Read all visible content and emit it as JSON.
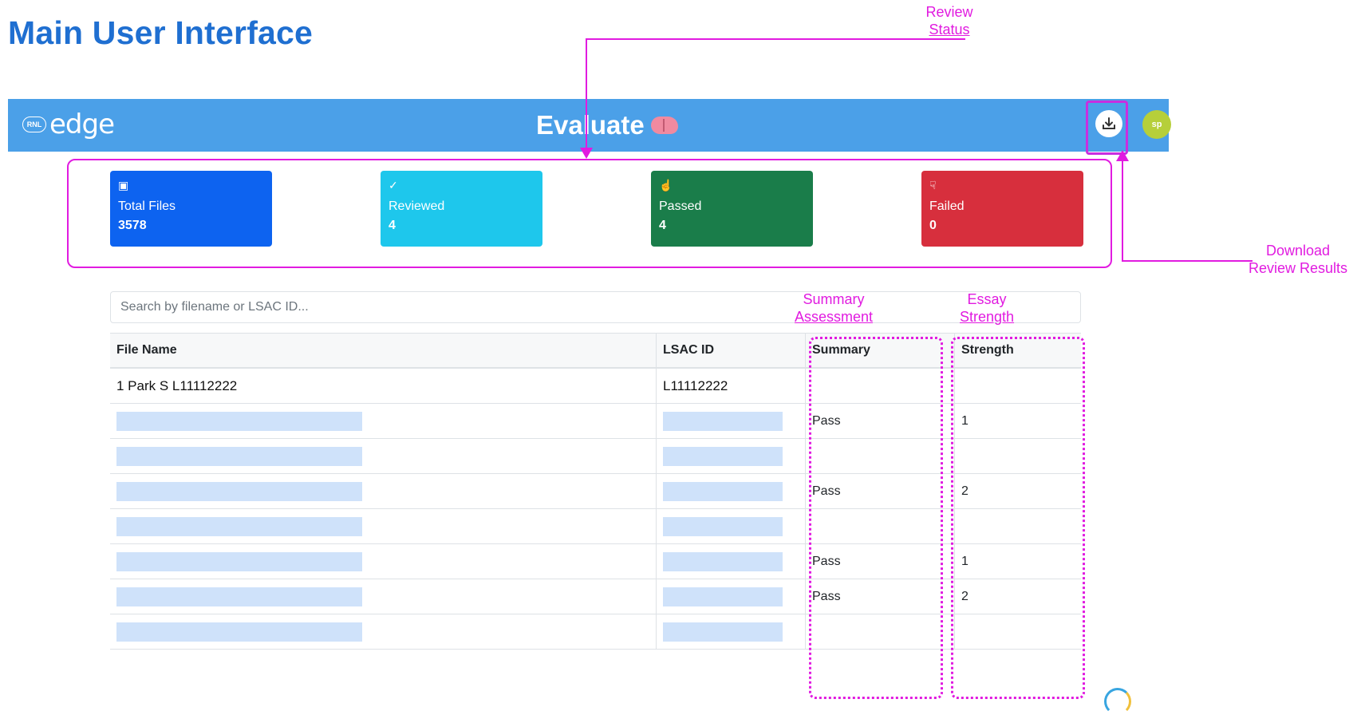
{
  "slide": {
    "title": "Main User Interface"
  },
  "header": {
    "logo_badge": "RNL",
    "logo_text": "edge",
    "title": "Evaluate",
    "avatar_initials": "sp"
  },
  "stats": [
    {
      "label": "Total Files",
      "value": "3578"
    },
    {
      "label": "Reviewed",
      "value": "4"
    },
    {
      "label": "Passed",
      "value": "4"
    },
    {
      "label": "Failed",
      "value": "0"
    }
  ],
  "search": {
    "placeholder": "Search by filename or LSAC ID..."
  },
  "table": {
    "headers": [
      "File Name",
      "LSAC ID",
      "Summary",
      "Strength"
    ],
    "rows": [
      {
        "file": "1 Park S L11112222",
        "lsac": "L11112222",
        "summary": "",
        "strength": ""
      },
      {
        "file": "",
        "lsac": "",
        "summary": "Pass",
        "strength": "1"
      },
      {
        "file": "",
        "lsac": "",
        "summary": "",
        "strength": ""
      },
      {
        "file": "",
        "lsac": "",
        "summary": "Pass",
        "strength": "2"
      },
      {
        "file": "",
        "lsac": "",
        "summary": "",
        "strength": ""
      },
      {
        "file": "",
        "lsac": "",
        "summary": "Pass",
        "strength": "1"
      },
      {
        "file": "",
        "lsac": "",
        "summary": "Pass",
        "strength": "2"
      },
      {
        "file": "",
        "lsac": "",
        "summary": "",
        "strength": ""
      }
    ]
  },
  "annotations": {
    "review_status_line1": "Review",
    "review_status_line2": "Status",
    "download_line1": "Download",
    "download_line2": "Review Results",
    "summary_line1": "Summary",
    "summary_line2": "Assessment",
    "essay_line1": "Essay",
    "essay_line2": "Strength"
  },
  "colors": {
    "accent": "#4ba0e8",
    "total": "#0d63f0",
    "reviewed": "#1ec7ec",
    "passed": "#1a7d4a",
    "failed": "#d72f3d",
    "annotation": "#e11be0"
  }
}
